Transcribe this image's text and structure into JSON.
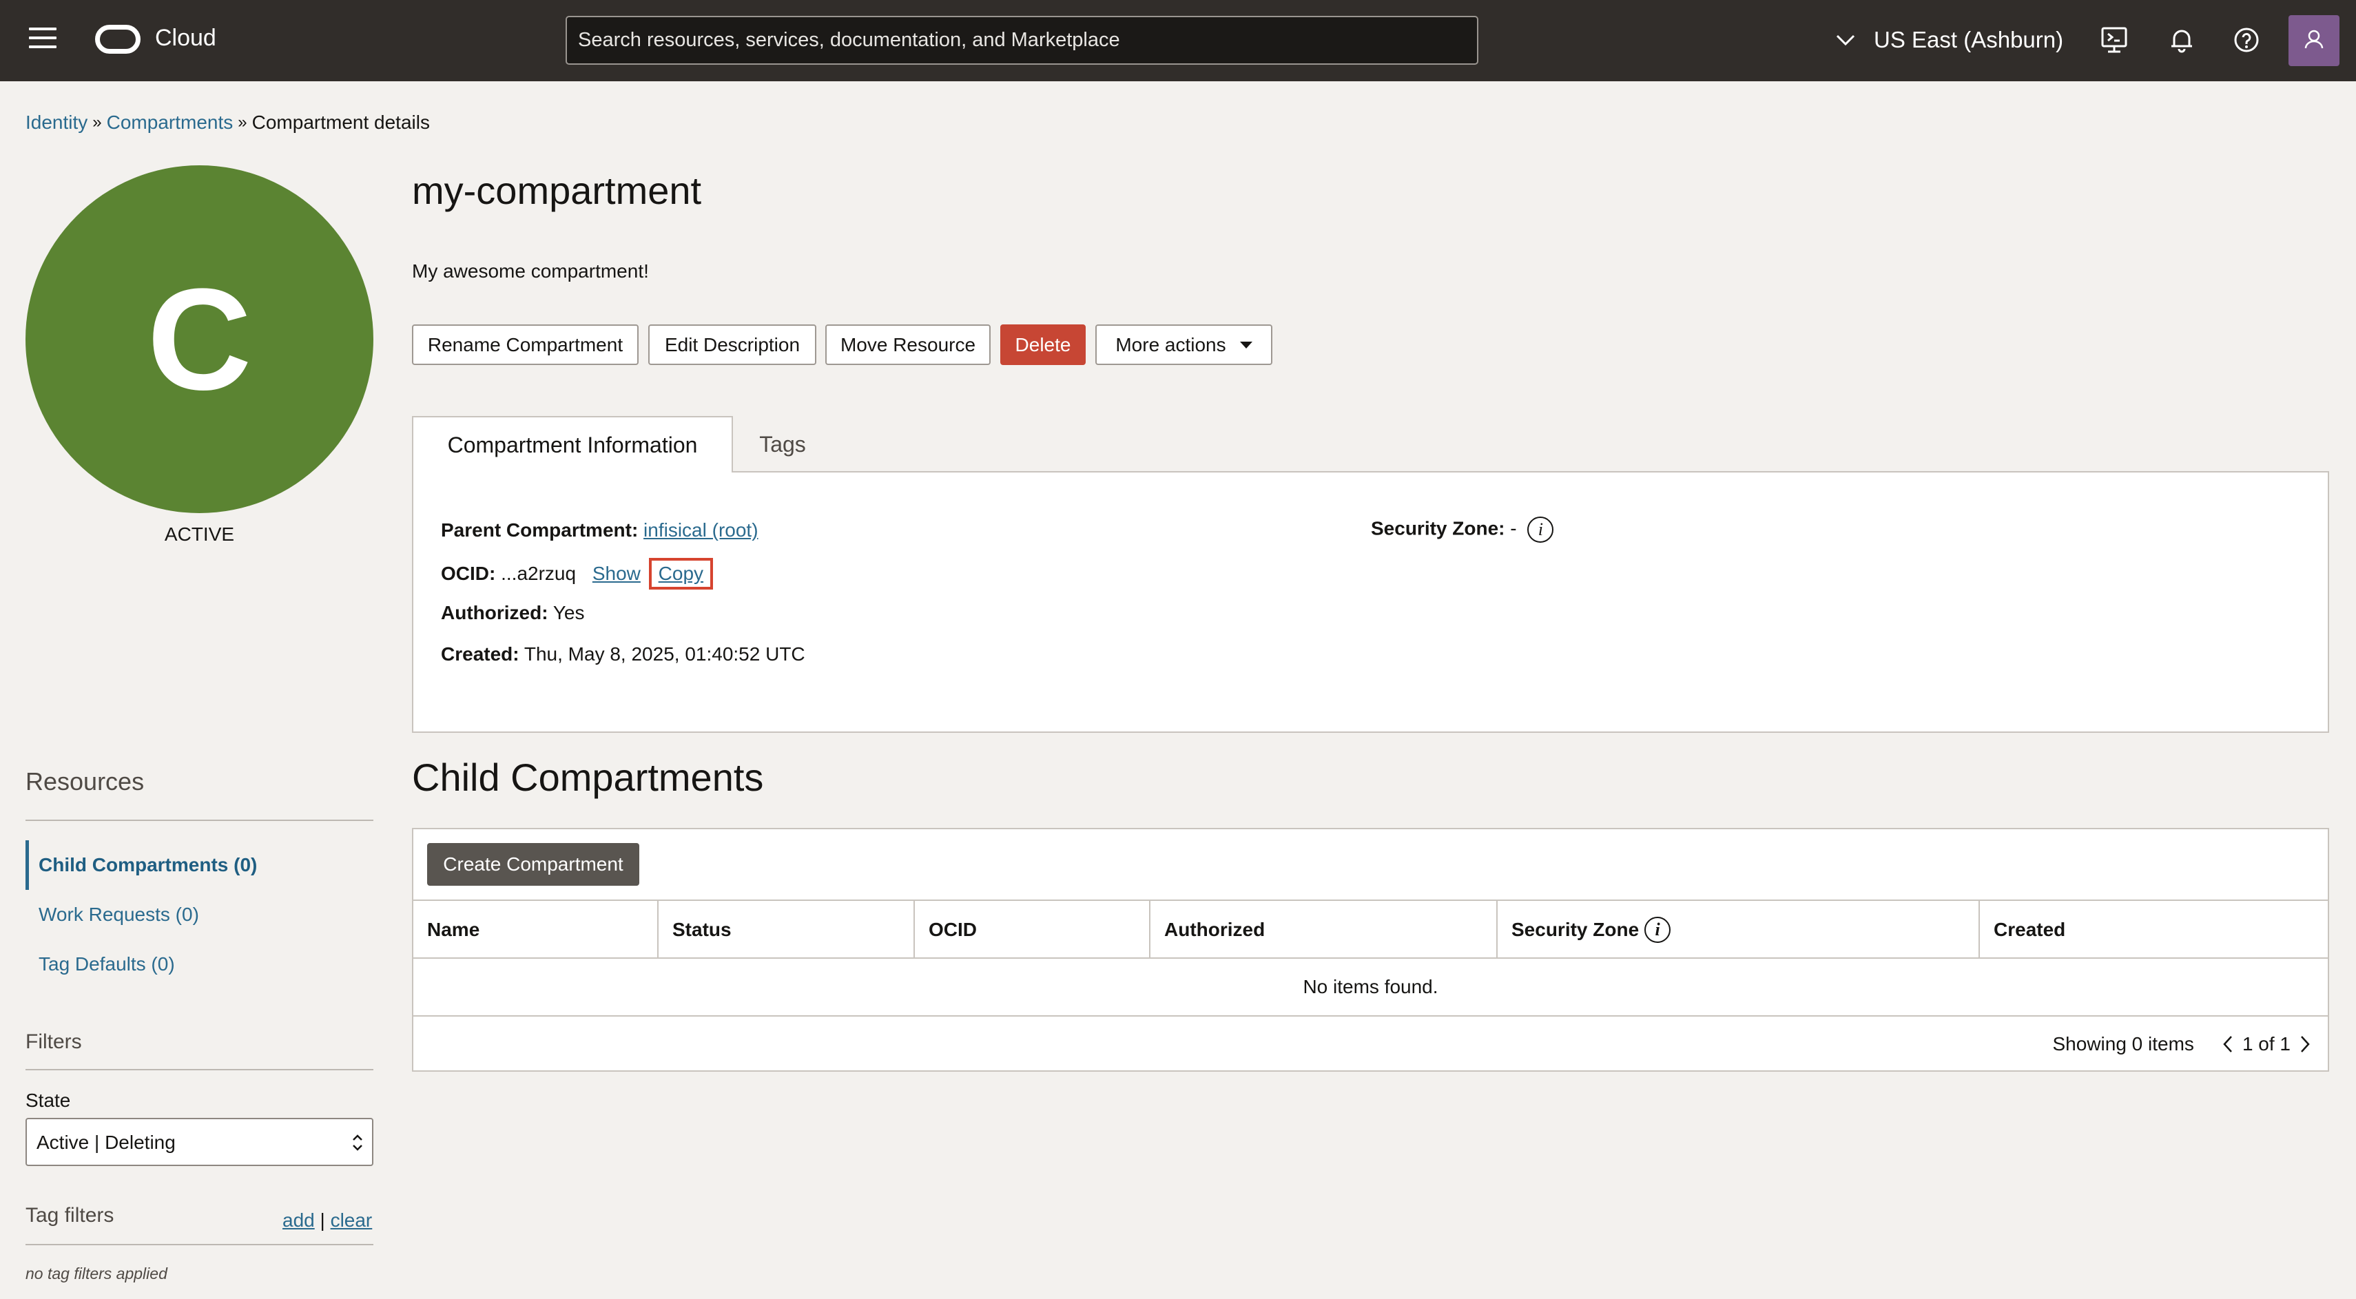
{
  "topbar": {
    "brand": "Cloud",
    "search_placeholder": "Search resources, services, documentation, and Marketplace",
    "region": "US East (Ashburn)"
  },
  "breadcrumb": {
    "items": [
      "Identity",
      "Compartments"
    ],
    "current": "Compartment details"
  },
  "compartment": {
    "avatar_letter": "C",
    "state": "ACTIVE",
    "name": "my-compartment",
    "description": "My awesome compartment!"
  },
  "actions": {
    "rename": "Rename Compartment",
    "edit_description": "Edit Description",
    "move": "Move Resource",
    "delete": "Delete",
    "more": "More actions"
  },
  "tabs": [
    "Compartment Information",
    "Tags"
  ],
  "info": {
    "parent_label": "Parent Compartment:",
    "parent_value": "infisical (root)",
    "ocid_label": "OCID:",
    "ocid_value": "...a2rzuq",
    "show_link": "Show",
    "copy_link": "Copy",
    "authorized_label": "Authorized:",
    "authorized_value": "Yes",
    "created_label": "Created:",
    "created_value": "Thu, May 8, 2025, 01:40:52 UTC",
    "security_zone_label": "Security Zone:",
    "security_zone_value": "-"
  },
  "sidebar": {
    "resources_heading": "Resources",
    "items": [
      {
        "label": "Child Compartments (0)"
      },
      {
        "label": "Work Requests (0)"
      },
      {
        "label": "Tag Defaults (0)"
      }
    ],
    "filters_heading": "Filters",
    "state_label": "State",
    "state_value": "Active | Deleting",
    "tag_filters_heading": "Tag filters",
    "add_link": "add",
    "clear_link": "clear",
    "no_tag_filters": "no tag filters applied"
  },
  "child_compartments": {
    "title": "Child Compartments",
    "create_button": "Create Compartment",
    "columns": [
      "Name",
      "Status",
      "OCID",
      "Authorized",
      "Security Zone",
      "Created"
    ],
    "empty_message": "No items found.",
    "showing": "Showing 0 items",
    "page": "1 of 1"
  },
  "colors": {
    "topbar": "#312d2a",
    "avatar": "#5b8432",
    "danger": "#c74634",
    "link": "#2a6a8e",
    "highlight": "#d6442f"
  }
}
